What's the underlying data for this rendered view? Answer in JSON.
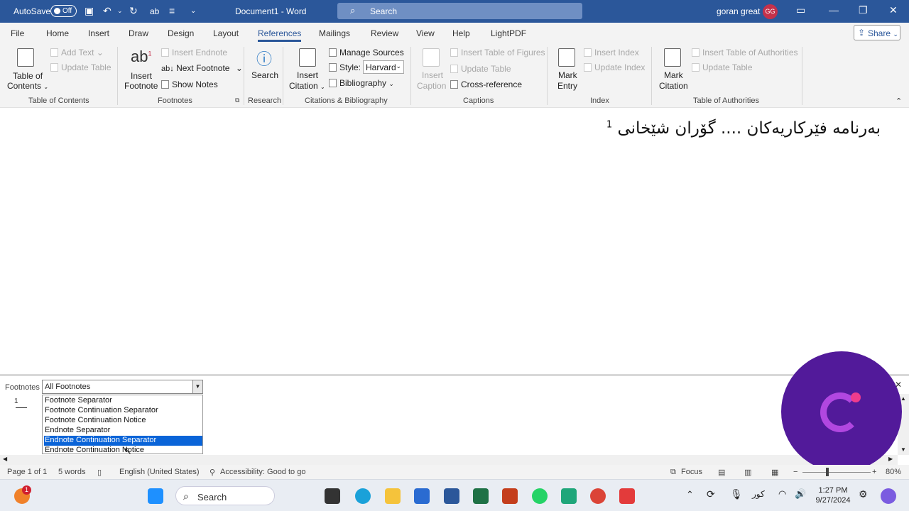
{
  "titlebar": {
    "autosave_label": "AutoSave",
    "autosave_state": "Off",
    "doc_title": "Document1 - Word",
    "search_placeholder": "Search",
    "user_name": "goran great",
    "user_initials": "GG"
  },
  "tabs": [
    "File",
    "Home",
    "Insert",
    "Draw",
    "Design",
    "Layout",
    "References",
    "Mailings",
    "Review",
    "View",
    "Help",
    "LightPDF"
  ],
  "active_tab": "References",
  "share_label": "Share",
  "ribbon": {
    "toc": {
      "button": "Table of Contents",
      "line1": "Table of",
      "line2": "Contents",
      "add_text": "Add Text",
      "update_table": "Update Table",
      "group": "Table of Contents"
    },
    "footnotes": {
      "insert_line1": "Insert",
      "insert_line2": "Footnote",
      "insert_endnote": "Insert Endnote",
      "next_footnote": "Next Footnote",
      "show_notes": "Show Notes",
      "group": "Footnotes"
    },
    "research": {
      "search": "Search",
      "group": "Research"
    },
    "citations": {
      "insert_line1": "Insert",
      "insert_line2": "Citation",
      "manage_sources": "Manage Sources",
      "style_label": "Style:",
      "style_value": "Harvard",
      "bibliography": "Bibliography",
      "group": "Citations & Bibliography"
    },
    "captions": {
      "insert_line1": "Insert",
      "insert_line2": "Caption",
      "insert_tof": "Insert Table of Figures",
      "update_table": "Update Table",
      "cross_reference": "Cross-reference",
      "group": "Captions"
    },
    "index": {
      "mark_line1": "Mark",
      "mark_line2": "Entry",
      "insert_index": "Insert Index",
      "update_index": "Update Index",
      "group": "Index"
    },
    "authorities": {
      "mark_line1": "Mark",
      "mark_line2": "Citation",
      "insert_toa": "Insert Table of Authorities",
      "update_table": "Update Table",
      "group": "Table of Authorities"
    }
  },
  "document": {
    "text": "بەرنامە فێرکاریەکان .... گۆران شێخانی",
    "footnote_ref": "1"
  },
  "footnote_pane": {
    "label": "Footnotes",
    "combo_value": "All Footnotes",
    "options": [
      "Footnote Separator",
      "Footnote Continuation Separator",
      "Footnote Continuation Notice",
      "Endnote Separator",
      "Endnote Continuation Separator",
      "Endnote Continuation Notice"
    ],
    "selected_index": 4,
    "footnote_number": "1"
  },
  "status": {
    "page": "Page 1 of 1",
    "words": "5 words",
    "language": "English (United States)",
    "accessibility": "Accessibility: Good to go",
    "focus": "Focus",
    "zoom": "80%"
  },
  "taskbar": {
    "search": "Search",
    "lang": "کور",
    "time": "1:27 PM",
    "date": "9/27/2024",
    "notification_count": "1"
  }
}
